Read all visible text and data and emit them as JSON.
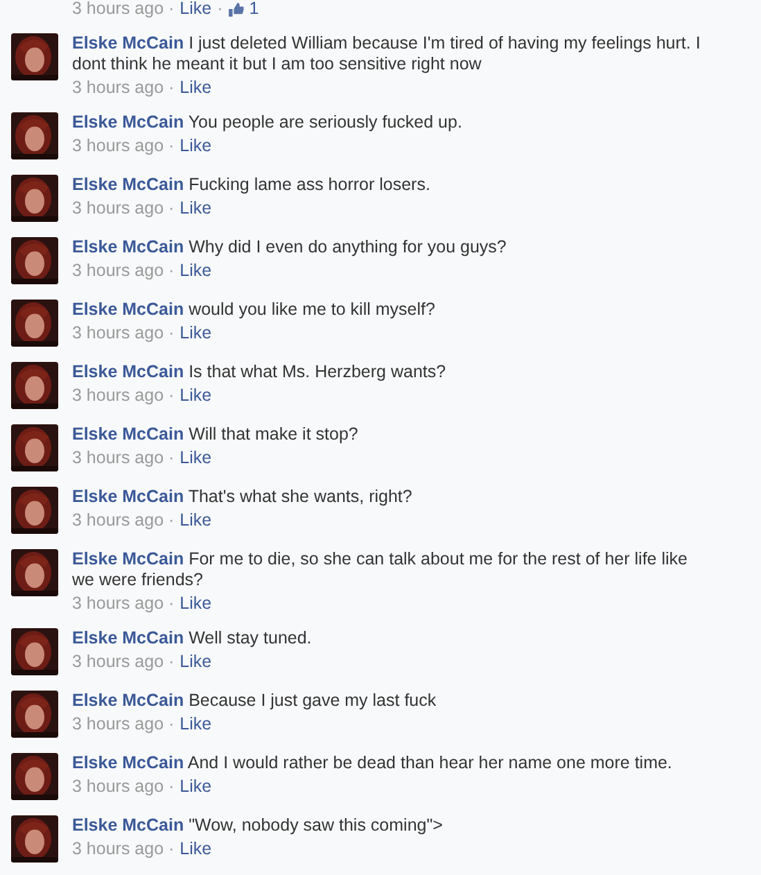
{
  "top_meta": {
    "time": "3 hours ago ·",
    "like": "Like",
    "dot": "·",
    "like_count": "1"
  },
  "comments": [
    {
      "author": "Elske McCain",
      "text": "I just deleted William because I'm tired of having my feelings hurt. I dont think he meant it but I am too sensitive right now",
      "time": "3 hours ago ·",
      "like": "Like"
    },
    {
      "author": "Elske McCain",
      "text": "You people are seriously fucked up.",
      "time": "3 hours ago ·",
      "like": "Like"
    },
    {
      "author": "Elske McCain",
      "text": "Fucking lame ass horror losers.",
      "time": "3 hours ago ·",
      "like": "Like"
    },
    {
      "author": "Elske McCain",
      "text": "Why did I even do anything for you guys?",
      "time": "3 hours ago ·",
      "like": "Like"
    },
    {
      "author": "Elske McCain",
      "text": "would you like me to kill myself?",
      "time": "3 hours ago ·",
      "like": "Like"
    },
    {
      "author": "Elske McCain",
      "text": "Is that what Ms. Herzberg wants?",
      "time": "3 hours ago ·",
      "like": "Like"
    },
    {
      "author": "Elske McCain",
      "text": "Will that make it stop?",
      "time": "3 hours ago ·",
      "like": "Like"
    },
    {
      "author": "Elske McCain",
      "text": "That's what she wants, right?",
      "time": "3 hours ago ·",
      "like": "Like"
    },
    {
      "author": "Elske McCain",
      "text": "For me to die, so she can talk about me for the rest of her life like we were friends?",
      "time": "3 hours ago ·",
      "like": "Like"
    },
    {
      "author": "Elske McCain",
      "text": "Well stay tuned.",
      "time": "3 hours ago ·",
      "like": "Like"
    },
    {
      "author": "Elske McCain",
      "text": "Because I just gave my last fuck",
      "time": "3 hours ago ·",
      "like": "Like"
    },
    {
      "author": "Elske McCain",
      "text": "And I would rather be dead than hear her name one more time.",
      "time": "3 hours ago ·",
      "like": "Like"
    },
    {
      "author": "Elske McCain",
      "text": "\"Wow, nobody saw this coming\">",
      "time": "3 hours ago ·",
      "like": "Like"
    }
  ]
}
